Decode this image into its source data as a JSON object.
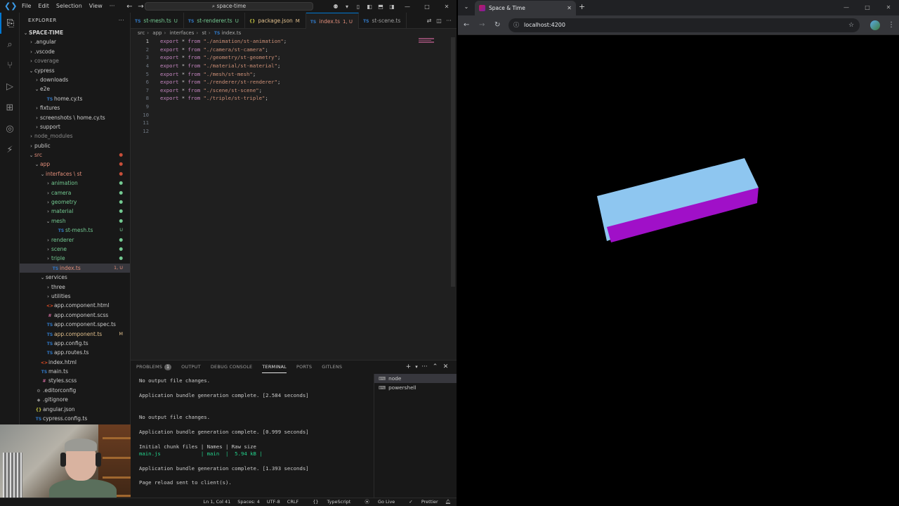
{
  "vscode": {
    "menu": [
      "File",
      "Edit",
      "Selection",
      "View"
    ],
    "search": "space-time",
    "explorer_title": "EXPLORER",
    "tree": [
      {
        "label": "SPACE-TIME",
        "indent": 0,
        "chev": "⌄",
        "cls": "",
        "badge": ""
      },
      {
        "label": ".angular",
        "indent": 1,
        "chev": "›",
        "cls": "",
        "badge": ""
      },
      {
        "label": ".vscode",
        "indent": 1,
        "chev": "›",
        "cls": "",
        "badge": ""
      },
      {
        "label": "coverage",
        "indent": 1,
        "chev": "›",
        "cls": "c-dim",
        "badge": ""
      },
      {
        "label": "cypress",
        "indent": 1,
        "chev": "⌄",
        "cls": "",
        "badge": ""
      },
      {
        "label": "downloads",
        "indent": 2,
        "chev": "›",
        "cls": "",
        "badge": ""
      },
      {
        "label": "e2e",
        "indent": 2,
        "chev": "⌄",
        "cls": "",
        "badge": ""
      },
      {
        "label": "home.cy.ts",
        "indent": 3,
        "chev": "",
        "icon": "TS",
        "cls": "",
        "badge": ""
      },
      {
        "label": "fixtures",
        "indent": 2,
        "chev": "›",
        "cls": "",
        "badge": ""
      },
      {
        "label": "screenshots \\ home.cy.ts",
        "indent": 2,
        "chev": "›",
        "cls": "",
        "badge": ""
      },
      {
        "label": "support",
        "indent": 2,
        "chev": "›",
        "cls": "",
        "badge": ""
      },
      {
        "label": "node_modules",
        "indent": 1,
        "chev": "›",
        "cls": "c-dim",
        "badge": ""
      },
      {
        "label": "public",
        "indent": 1,
        "chev": "›",
        "cls": "",
        "badge": ""
      },
      {
        "label": "src",
        "indent": 1,
        "chev": "⌄",
        "cls": "c-red",
        "badge": "●",
        "badgecls": "dot-r"
      },
      {
        "label": "app",
        "indent": 2,
        "chev": "⌄",
        "cls": "c-red",
        "badge": "●",
        "badgecls": "dot-r"
      },
      {
        "label": "interfaces \\ st",
        "indent": 3,
        "chev": "⌄",
        "cls": "c-red",
        "badge": "●",
        "badgecls": "dot-r"
      },
      {
        "label": "animation",
        "indent": 4,
        "chev": "›",
        "cls": "c-green",
        "badge": "●",
        "badgecls": "dot-g"
      },
      {
        "label": "camera",
        "indent": 4,
        "chev": "›",
        "cls": "c-green",
        "badge": "●",
        "badgecls": "dot-g"
      },
      {
        "label": "geometry",
        "indent": 4,
        "chev": "›",
        "cls": "c-green",
        "badge": "●",
        "badgecls": "dot-g"
      },
      {
        "label": "material",
        "indent": 4,
        "chev": "›",
        "cls": "c-green",
        "badge": "●",
        "badgecls": "dot-g"
      },
      {
        "label": "mesh",
        "indent": 4,
        "chev": "⌄",
        "cls": "c-green",
        "badge": "●",
        "badgecls": "dot-g"
      },
      {
        "label": "st-mesh.ts",
        "indent": 5,
        "chev": "",
        "icon": "TS",
        "cls": "c-green",
        "badge": "U",
        "badgecls": "c-green"
      },
      {
        "label": "renderer",
        "indent": 4,
        "chev": "›",
        "cls": "c-green",
        "badge": "●",
        "badgecls": "dot-g"
      },
      {
        "label": "scene",
        "indent": 4,
        "chev": "›",
        "cls": "c-green",
        "badge": "●",
        "badgecls": "dot-g"
      },
      {
        "label": "triple",
        "indent": 4,
        "chev": "›",
        "cls": "c-green",
        "badge": "●",
        "badgecls": "dot-g"
      },
      {
        "label": "index.ts",
        "indent": 4,
        "chev": "",
        "icon": "TS",
        "cls": "c-red",
        "badge": "1, U",
        "badgecls": "c-red",
        "selected": true
      },
      {
        "label": "services",
        "indent": 3,
        "chev": "⌄",
        "cls": "",
        "badge": ""
      },
      {
        "label": "three",
        "indent": 4,
        "chev": "›",
        "cls": "",
        "badge": ""
      },
      {
        "label": "utilities",
        "indent": 4,
        "chev": "›",
        "cls": "",
        "badge": ""
      },
      {
        "label": "app.component.html",
        "indent": 3,
        "chev": "",
        "icon": "<>",
        "cls": "",
        "badge": ""
      },
      {
        "label": "app.component.scss",
        "indent": 3,
        "chev": "",
        "icon": "#",
        "cls": "",
        "badge": ""
      },
      {
        "label": "app.component.spec.ts",
        "indent": 3,
        "chev": "",
        "icon": "TS",
        "cls": "",
        "badge": ""
      },
      {
        "label": "app.component.ts",
        "indent": 3,
        "chev": "",
        "icon": "TS",
        "cls": "c-yellow",
        "badge": "M",
        "badgecls": "c-yellow"
      },
      {
        "label": "app.config.ts",
        "indent": 3,
        "chev": "",
        "icon": "TS",
        "cls": "",
        "badge": ""
      },
      {
        "label": "app.routes.ts",
        "indent": 3,
        "chev": "",
        "icon": "TS",
        "cls": "",
        "badge": ""
      },
      {
        "label": "index.html",
        "indent": 2,
        "chev": "",
        "icon": "<>",
        "cls": "",
        "badge": ""
      },
      {
        "label": "main.ts",
        "indent": 2,
        "chev": "",
        "icon": "TS",
        "cls": "",
        "badge": ""
      },
      {
        "label": "styles.scss",
        "indent": 2,
        "chev": "",
        "icon": "#",
        "cls": "",
        "badge": ""
      },
      {
        "label": ".editorconfig",
        "indent": 1,
        "chev": "",
        "icon": "⚙",
        "cls": "",
        "badge": ""
      },
      {
        "label": ".gitignore",
        "indent": 1,
        "chev": "",
        "icon": "◆",
        "cls": "",
        "badge": ""
      },
      {
        "label": "angular.json",
        "indent": 1,
        "chev": "",
        "icon": "{}",
        "cls": "",
        "badge": ""
      },
      {
        "label": "cypress.config.ts",
        "indent": 1,
        "chev": "",
        "icon": "TS",
        "cls": "",
        "badge": ""
      }
    ],
    "tabs": [
      {
        "label": "st-mesh.ts",
        "icon": "TS",
        "mod": "U",
        "modcls": "c-green",
        "active": false
      },
      {
        "label": "st-renderer.ts",
        "icon": "TS",
        "mod": "U",
        "modcls": "c-green",
        "active": false
      },
      {
        "label": "package.json",
        "icon": "{}",
        "mod": "M",
        "modcls": "c-yellow",
        "active": false
      },
      {
        "label": "index.ts",
        "icon": "TS",
        "mod": "1, U",
        "modcls": "c-red",
        "active": true
      },
      {
        "label": "st-scene.ts",
        "icon": "TS",
        "mod": "",
        "modcls": "",
        "active": false
      }
    ],
    "breadcrumb": [
      "src",
      "app",
      "interfaces",
      "st",
      "index.ts"
    ],
    "code": [
      {
        "n": "1",
        "kw1": "export",
        "mid": " * ",
        "kw2": "from",
        "path": "\"./animation/st-animation\"",
        "end": ";"
      },
      {
        "n": "2",
        "kw1": "export",
        "mid": " * ",
        "kw2": "from",
        "path": "\"./camera/st-camera\"",
        "end": ";"
      },
      {
        "n": "3",
        "kw1": "export",
        "mid": " * ",
        "kw2": "from",
        "path": "\"./geometry/st-geometry\"",
        "end": ";"
      },
      {
        "n": "4",
        "kw1": "export",
        "mid": " * ",
        "kw2": "from",
        "path": "\"./material/st-material\"",
        "end": ";"
      },
      {
        "n": "5",
        "kw1": "export",
        "mid": " * ",
        "kw2": "from",
        "path": "\"./mesh/st-mesh\"",
        "end": ";"
      },
      {
        "n": "6",
        "kw1": "export",
        "mid": " * ",
        "kw2": "from",
        "path": "\"./renderer/st-renderer\"",
        "end": ";"
      },
      {
        "n": "7",
        "kw1": "export",
        "mid": " * ",
        "kw2": "from",
        "path": "\"./scene/st-scene\"",
        "end": ";"
      },
      {
        "n": "8",
        "kw1": "export",
        "mid": " * ",
        "kw2": "from",
        "path": "\"./triple/st-triple\"",
        "end": ";"
      },
      {
        "n": "9",
        "kw1": "",
        "mid": "",
        "kw2": "",
        "path": "",
        "end": ""
      },
      {
        "n": "10",
        "kw1": "",
        "mid": "",
        "kw2": "",
        "path": "",
        "end": ""
      },
      {
        "n": "11",
        "kw1": "",
        "mid": "",
        "kw2": "",
        "path": "",
        "end": ""
      },
      {
        "n": "12",
        "kw1": "",
        "mid": "",
        "kw2": "",
        "path": "",
        "end": ""
      }
    ],
    "panel": {
      "tabs": [
        "PROBLEMS",
        "OUTPUT",
        "DEBUG CONSOLE",
        "TERMINAL",
        "PORTS",
        "GITLENS"
      ],
      "problems_count": "1",
      "active_tab": "TERMINAL",
      "terminal_lines": [
        {
          "text": "No output file changes.",
          "cls": ""
        },
        {
          "text": "",
          "cls": ""
        },
        {
          "text": "Application bundle generation complete. [2.584 seconds]",
          "cls": ""
        },
        {
          "text": "",
          "cls": ""
        },
        {
          "text": "",
          "cls": ""
        },
        {
          "text": "No output file changes.",
          "cls": ""
        },
        {
          "text": "",
          "cls": ""
        },
        {
          "text": "Application bundle generation complete. [0.999 seconds]",
          "cls": ""
        },
        {
          "text": "",
          "cls": ""
        },
        {
          "text": "Initial chunk files | Names | Raw size",
          "cls": ""
        },
        {
          "text": "main.js             | main  |  5.94 kB |",
          "cls": "term-green"
        },
        {
          "text": "",
          "cls": ""
        },
        {
          "text": "Application bundle generation complete. [1.393 seconds]",
          "cls": ""
        },
        {
          "text": "",
          "cls": ""
        },
        {
          "text": "Page reload sent to client(s).",
          "cls": ""
        }
      ],
      "terminals": [
        "node",
        "powershell"
      ]
    },
    "status": {
      "position": "Ln 1, Col 41",
      "spaces": "Spaces: 4",
      "encoding": "UTF-8",
      "eol": "CRLF",
      "language": "TypeScript",
      "golive": "Go Live",
      "prettier": "Prettier"
    }
  },
  "browser": {
    "tab_title": "Space & Time",
    "url": "localhost:4200",
    "scene": {
      "background": "#000000",
      "box_top_color": "#8ec6f0",
      "box_front_color": "#a010c8",
      "box_side_color": "#8a0fb0"
    }
  }
}
